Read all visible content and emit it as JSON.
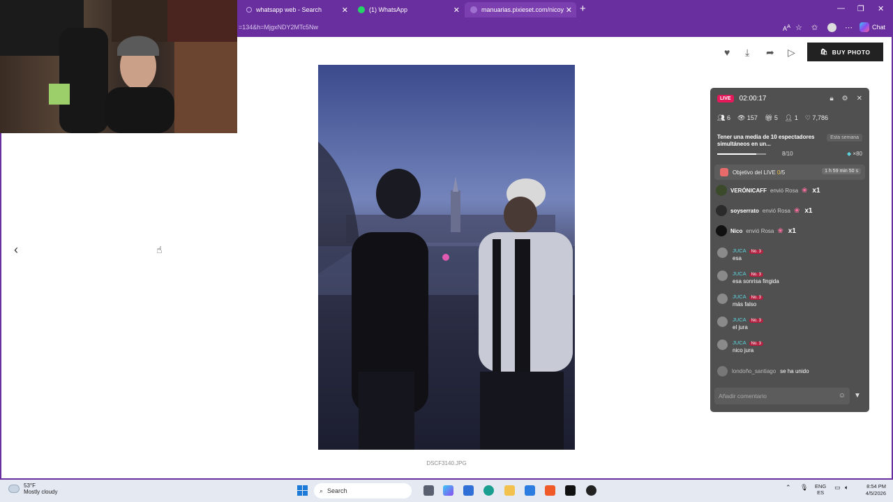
{
  "browser": {
    "tabs": [
      {
        "label": "whatsapp web - Search",
        "icon": "search-icon",
        "color": "#6a2f9e"
      },
      {
        "label": "(1) WhatsApp",
        "icon": "whatsapp-icon",
        "color": "#25d366"
      },
      {
        "label": "manuarias.pixieset.com/nicoysantiago",
        "icon": "pixieset-icon",
        "color": "#7b3fb0"
      }
    ],
    "address": "=134&h=MjgxNDY2MTc5Nw",
    "chat_label": "Chat",
    "accent": "#6a2f9e"
  },
  "gallery": {
    "buy_label": "BUY PHOTO",
    "filename": "DSCF3140.JPG",
    "icons": [
      "heart-icon",
      "download-icon",
      "share-icon",
      "play-icon"
    ]
  },
  "live": {
    "badge": "LIVE",
    "timer": "02:00:17",
    "stats": {
      "viewers_now": "6",
      "views": "157",
      "gifts": "5",
      "shares": "1",
      "likes": "7,786"
    },
    "goal": {
      "text": "Tener una media de 10 espectadores simultáneos en un...",
      "period": "Esta semana",
      "progress": "8/10",
      "progress_fraction": 0.8,
      "reward": "×80"
    },
    "objective": {
      "label_prefix": "Objetivo del LIVE",
      "count_current": "0",
      "count_total": "/5",
      "time_left": "1 h 59 min 50 s"
    },
    "gifts": [
      {
        "user": "VERÓNICAFF",
        "action": "envió Rosa",
        "count": "x1"
      },
      {
        "user": "soyserrato",
        "action": "envió Rosa",
        "count": "x1"
      },
      {
        "user": "Nico",
        "action": "envió Rosa",
        "count": "x1"
      }
    ],
    "comments": [
      {
        "user": "JUCA",
        "rank": "No. 3",
        "text": "esa"
      },
      {
        "user": "JUCA",
        "rank": "No. 3",
        "text": "esa sonrisa fingida"
      },
      {
        "user": "JUCA",
        "rank": "No. 3",
        "text": "más falso"
      },
      {
        "user": "JUCA",
        "rank": "No. 3",
        "text": "el jura"
      },
      {
        "user": "JUCA",
        "rank": "No. 3",
        "text": "nico jura"
      }
    ],
    "join": {
      "user": "londoño_santiago",
      "text": "se ha unido"
    },
    "input_placeholder": "Añadir comentario"
  },
  "taskbar": {
    "temperature": "53°F",
    "weather": "Mostly cloudy",
    "search_label": "Search",
    "lang_top": "ENG",
    "lang_bottom": "ES",
    "time": "8:54 PM",
    "date": "4/5/2026"
  }
}
